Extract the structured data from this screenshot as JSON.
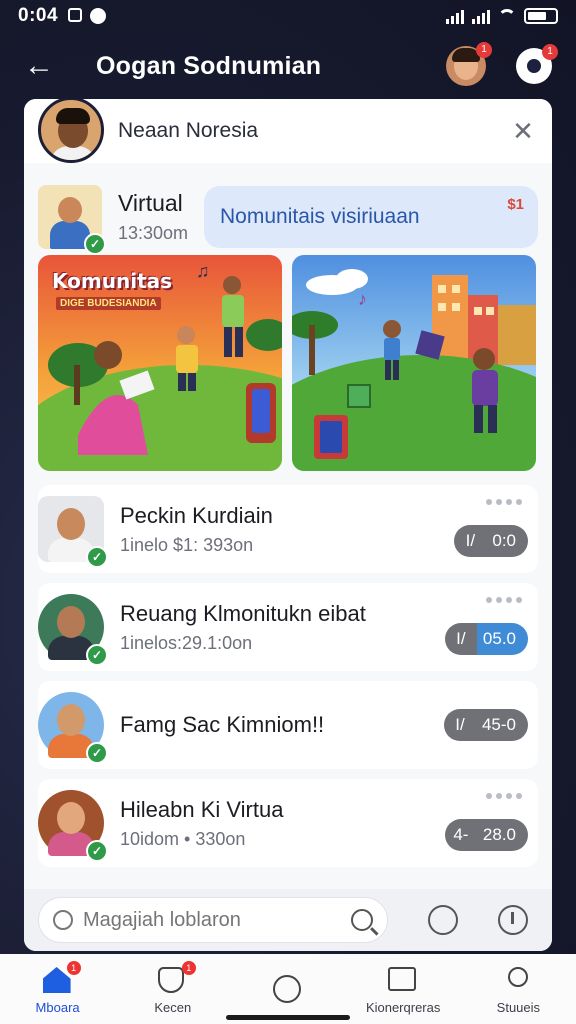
{
  "status_bar": {
    "time": "0:04"
  },
  "header": {
    "title": "Oogan Sodnumian",
    "avatar_badge": "1",
    "app_badge": "1"
  },
  "profile": {
    "name": "Neaan Noresia"
  },
  "virtual": {
    "title": "Virtual",
    "time": "13:30om",
    "bubble_text": "Nomunitais visiriuaan",
    "bubble_badge": "$1"
  },
  "images": [
    {
      "label": "Komunitas",
      "sublabel": "DIGE BUDESIANDIA"
    },
    {
      "label": ""
    }
  ],
  "list": [
    {
      "title": "Peckin Kurdiain",
      "sub": "1inelo $1: 393on",
      "pill_left": "І/",
      "pill_right": "0:0",
      "pill_style": "gray",
      "has_dots": true
    },
    {
      "title": "Reuang Klmonitukn eibat",
      "sub": "1inelos:29.1:0on",
      "pill_left": "І/",
      "pill_right": "05.0",
      "pill_style": "blue",
      "has_dots": true
    },
    {
      "title": "Famg Sac Kimniom!!",
      "sub": "",
      "pill_left": "І/",
      "pill_right": "45-0",
      "pill_style": "gray",
      "has_dots": false
    },
    {
      "title": "Hileabn Ki Virtua",
      "sub": "10idom • 330on",
      "pill_left": "4-",
      "pill_right": "28.0",
      "pill_style": "gray",
      "has_dots": true
    }
  ],
  "search": {
    "placeholder": "Magajiah loblaron"
  },
  "nav": [
    {
      "label": "Mboara",
      "icon": "home-icon",
      "badge": "1",
      "active": true
    },
    {
      "label": "Kecen",
      "icon": "heart-icon",
      "badge": "1",
      "active": false
    },
    {
      "label": "",
      "icon": "compass-icon",
      "badge": "",
      "active": false
    },
    {
      "label": "Kionerqreras",
      "icon": "inbox-icon",
      "badge": "",
      "active": false
    },
    {
      "label": "Stuueis",
      "icon": "profile-icon",
      "badge": "",
      "active": false
    }
  ]
}
